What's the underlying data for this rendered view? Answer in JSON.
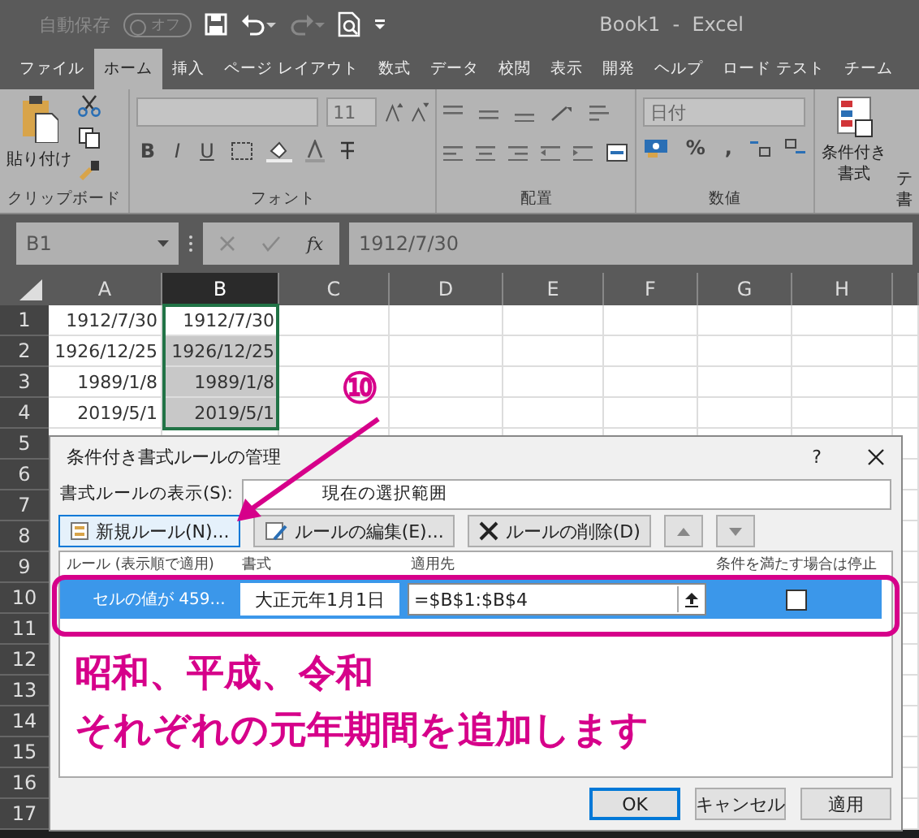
{
  "title_bar": {
    "autosave_label": "自動保存",
    "autosave_toggle": "オフ",
    "autosave_on": false,
    "title": "Book1  -  Excel"
  },
  "tabs": [
    {
      "label": "ファイル",
      "selected": false
    },
    {
      "label": "ホーム",
      "selected": true
    },
    {
      "label": "挿入",
      "selected": false
    },
    {
      "label": "ページ レイアウト",
      "selected": false
    },
    {
      "label": "数式",
      "selected": false
    },
    {
      "label": "データ",
      "selected": false
    },
    {
      "label": "校閲",
      "selected": false
    },
    {
      "label": "表示",
      "selected": false
    },
    {
      "label": "開発",
      "selected": false
    },
    {
      "label": "ヘルプ",
      "selected": false
    },
    {
      "label": "ロード テスト",
      "selected": false
    },
    {
      "label": "チーム",
      "selected": false
    }
  ],
  "ribbon": {
    "clipboard": {
      "paste_label": "貼り付け",
      "group": "クリップボード"
    },
    "font": {
      "size": "11",
      "buttons": [
        "B",
        "I",
        "U"
      ],
      "group": "フォント"
    },
    "alignment": {
      "group": "配置"
    },
    "number": {
      "format": "日付",
      "buttons": [
        "%",
        ","
      ],
      "group": "数値"
    },
    "styles": {
      "conditional_label": [
        "条件付き",
        "書式"
      ],
      "cut_label": [
        "テ",
        "書"
      ]
    }
  },
  "formula_bar": {
    "name_box": "B1",
    "fx": "fx",
    "formula": "1912/7/30"
  },
  "columns": [
    {
      "label": "A",
      "selected": false
    },
    {
      "label": "B",
      "selected": true
    },
    {
      "label": "C",
      "selected": false
    },
    {
      "label": "D",
      "selected": false
    },
    {
      "label": "E",
      "selected": false
    },
    {
      "label": "F",
      "selected": false
    },
    {
      "label": "G",
      "selected": false
    },
    {
      "label": "H",
      "selected": false
    }
  ],
  "rows": [
    {
      "number": "1",
      "cells": [
        "1912/7/30",
        "1912/7/30"
      ]
    },
    {
      "number": "2",
      "cells": [
        "1926/12/25",
        "1926/12/25"
      ]
    },
    {
      "number": "3",
      "cells": [
        "1989/1/8",
        "1989/1/8"
      ]
    },
    {
      "number": "4",
      "cells": [
        "2019/5/1",
        "2019/5/1"
      ]
    },
    {
      "number": "5"
    },
    {
      "number": "6"
    },
    {
      "number": "7"
    },
    {
      "number": "8"
    },
    {
      "number": "9"
    },
    {
      "number": "10"
    },
    {
      "number": "11"
    },
    {
      "number": "12"
    },
    {
      "number": "13"
    },
    {
      "number": "14"
    },
    {
      "number": "15"
    },
    {
      "number": "16"
    },
    {
      "number": "17"
    }
  ],
  "dialog": {
    "title": "条件付き書式ルールの管理",
    "help": "?",
    "show_label": "書式ルールの表示(S):",
    "show_value": "現在の選択範囲",
    "toolbar": [
      {
        "kind": "new",
        "label": "新規ルール(N)...",
        "selected": true
      },
      {
        "kind": "edit",
        "label": "ルールの編集(E)...",
        "selected": false
      },
      {
        "kind": "delete",
        "label": "ルールの削除(D)",
        "selected": false
      },
      {
        "kind": "up",
        "selected": false
      },
      {
        "kind": "down",
        "selected": false
      }
    ],
    "headers": [
      "ルール (表示順で適用)",
      "書式",
      "適用先",
      "条件を満たす場合は停止"
    ],
    "rules": [
      {
        "rule": "セルの値が 459...",
        "preview": "大正元年1月1日",
        "applies_to": "=$B$1:$B$4",
        "stop_if_true": false,
        "selected": true
      }
    ],
    "buttons": [
      {
        "label": "OK",
        "default": true
      },
      {
        "label": "キャンセル",
        "default": false
      },
      {
        "label": "適用",
        "default": false
      }
    ]
  },
  "annotation": {
    "step": "⑩",
    "lines": [
      "昭和、平成、令和",
      "それぞれの元年期間を追加します"
    ]
  }
}
